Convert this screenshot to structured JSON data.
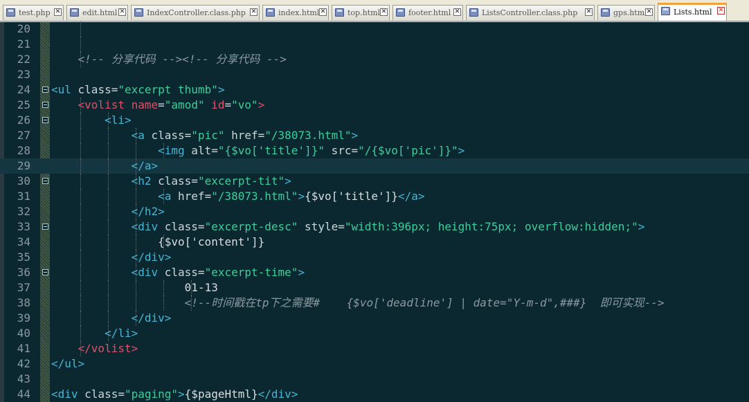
{
  "tabs": [
    {
      "label": "test.php",
      "active": false
    },
    {
      "label": "edit.html",
      "active": false
    },
    {
      "label": "IndexController.class.php",
      "active": false
    },
    {
      "label": "index.html",
      "active": false
    },
    {
      "label": "top.html",
      "active": false
    },
    {
      "label": "footer.html",
      "active": false
    },
    {
      "label": "ListsController.class.php",
      "active": false
    },
    {
      "label": "gps.html",
      "active": false
    },
    {
      "label": "Lists.html",
      "active": true
    }
  ],
  "editor": {
    "current_line": 29,
    "lines": [
      {
        "n": "20",
        "text": ""
      },
      {
        "n": "21",
        "text": ""
      },
      {
        "n": "22",
        "text": "    <!-- 分享代码 --><!-- 分享代码 -->"
      },
      {
        "n": "23",
        "text": ""
      },
      {
        "n": "24",
        "text": "<ul class=\"excerpt thumb\">"
      },
      {
        "n": "25",
        "text": "    <volist name=\"amod\" id=\"vo\">"
      },
      {
        "n": "26",
        "text": "        <li>"
      },
      {
        "n": "27",
        "text": "            <a class=\"pic\" href=\"/38073.html\">"
      },
      {
        "n": "28",
        "text": "                <img alt=\"{$vo['title']}\" src=\"/{$vo['pic']}\">"
      },
      {
        "n": "29",
        "text": "            </a>"
      },
      {
        "n": "30",
        "text": "            <h2 class=\"excerpt-tit\">"
      },
      {
        "n": "31",
        "text": "                <a href=\"/38073.html\">{$vo['title']}</a>"
      },
      {
        "n": "32",
        "text": "            </h2>"
      },
      {
        "n": "33",
        "text": "            <div class=\"excerpt-desc\" style=\"width:396px; height:75px; overflow:hidden;\">"
      },
      {
        "n": "34",
        "text": "                {$vo['content']}"
      },
      {
        "n": "35",
        "text": "            </div>"
      },
      {
        "n": "36",
        "text": "            <div class=\"excerpt-time\">"
      },
      {
        "n": "37",
        "text": "                    01-13"
      },
      {
        "n": "38",
        "text": "                    <!--时间戳在tp下之需要#    {$vo['deadline'] | date=\"Y-m-d\",###}  即可实现-->"
      },
      {
        "n": "39",
        "text": "            </div>"
      },
      {
        "n": "40",
        "text": "        </li>"
      },
      {
        "n": "41",
        "text": "    </volist>"
      },
      {
        "n": "42",
        "text": "</ul>"
      },
      {
        "n": "43",
        "text": ""
      },
      {
        "n": "44",
        "text": "<div class=\"paging\">{$pageHtml}</div>"
      }
    ]
  },
  "colors": {
    "background": "#0b2831",
    "tag": "#47b6d2",
    "volist_tag": "#e0506a",
    "string": "#3ccf9b",
    "comment": "#8b99a0",
    "active_tab_accent": "#f0a13a"
  }
}
